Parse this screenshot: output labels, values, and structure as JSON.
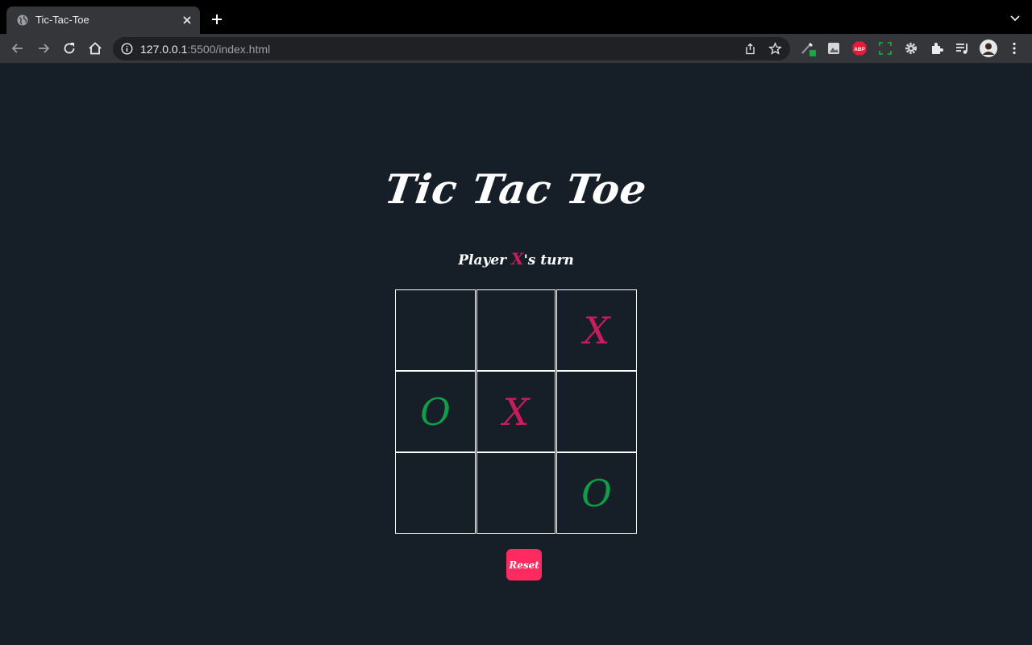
{
  "browser": {
    "tab_title": "Tic-Tac-Toe",
    "url_host": "127.0.0.1",
    "url_rest": ":5500/index.html",
    "extensions": [
      "eyedropper-ext-icon",
      "photo-ext-icon",
      "adblock-icon",
      "screenshot-ext-icon",
      "settings-ext-icon",
      "extensions-icon",
      "reading-list-icon",
      "profile-avatar"
    ]
  },
  "game": {
    "title": "Tic Tac Toe",
    "turn_prefix": "Player ",
    "turn_player": "X",
    "turn_suffix": "'s turn",
    "reset_label": "Reset",
    "board": [
      "",
      "",
      "X",
      "O",
      "X",
      "",
      "",
      "",
      "O"
    ]
  },
  "colors": {
    "background": "#161f27",
    "x_mark": "#c81d5c",
    "o_mark": "#0f9d4a",
    "reset_button": "#ff2a5f"
  }
}
